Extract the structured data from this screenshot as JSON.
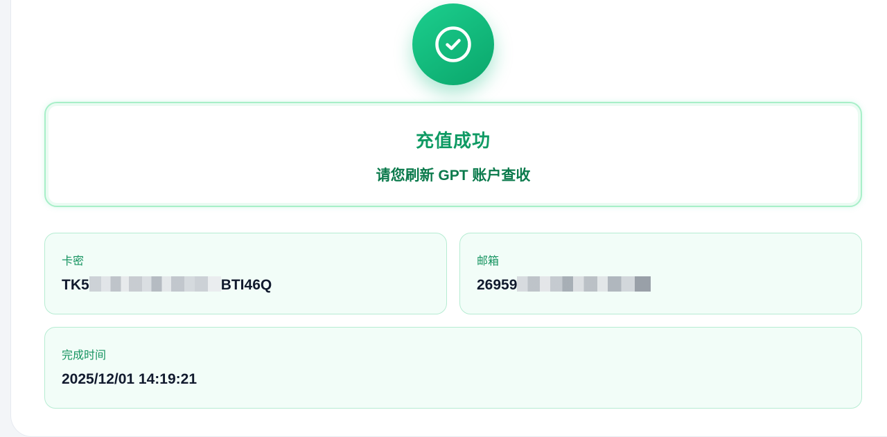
{
  "status": {
    "title": "充值成功",
    "subtitle": "请您刷新 GPT 账户查收",
    "icon": "check-circle-icon",
    "accent_color": "#10b981"
  },
  "card_key": {
    "label": "卡密",
    "value_prefix": "TK5",
    "value_suffix": "BTI46Q"
  },
  "email": {
    "label": "邮箱",
    "value_prefix": "26959"
  },
  "completed_time": {
    "label": "完成时间",
    "value": "2025/12/01 14:19:21"
  }
}
